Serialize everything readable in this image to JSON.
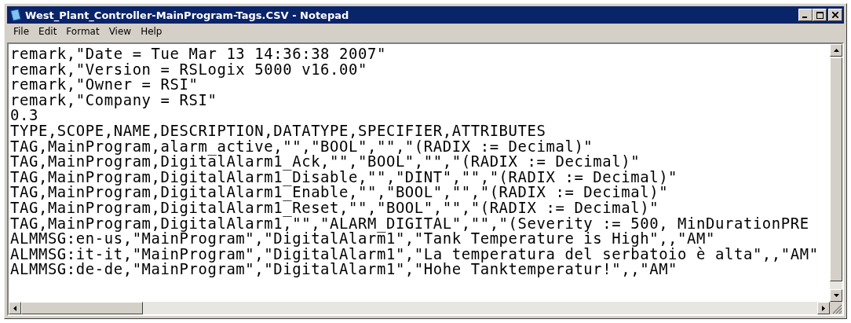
{
  "window": {
    "title": "West_Plant_Controller-MainProgram-Tags.CSV - Notepad"
  },
  "menu": [
    "File",
    "Edit",
    "Format",
    "View",
    "Help"
  ],
  "lines": [
    "remark,\"Date = Tue Mar 13 14:36:38 2007\"",
    "remark,\"Version = RSLogix 5000 v16.00\"",
    "remark,\"Owner = RSI\"",
    "remark,\"Company = RSI\"",
    "0.3",
    "TYPE,SCOPE,NAME,DESCRIPTION,DATATYPE,SPECIFIER,ATTRIBUTES",
    "TAG,MainProgram,alarm_active,\"\",\"BOOL\",\"\",\"(RADIX := Decimal)\"",
    "TAG,MainProgram,DigitalAlarm1_Ack,\"\",\"BOOL\",\"\",\"(RADIX := Decimal)\"",
    "TAG,MainProgram,DigitalAlarm1_Disable,\"\",\"DINT\",\"\",\"(RADIX := Decimal)\"",
    "TAG,MainProgram,DigitalAlarm1_Enable,\"\",\"BOOL\",\"\",\"(RADIX := Decimal)\"",
    "TAG,MainProgram,DigitalAlarm1_Reset,\"\",\"BOOL\",\"\",\"(RADIX := Decimal)\"",
    "TAG,MainProgram,DigitalAlarm1,\"\",\"ALARM_DIGITAL\",\"\",\"(Severity := 500, MinDurationPRE",
    "ALMMSG:en-us,\"MainProgram\",\"DigitalAlarm1\",\"Tank Temperature is High\",,\"AM\"",
    "ALMMSG:it-it,\"MainProgram\",\"DigitalAlarm1\",\"La temperatura del serbatoio è alta\",,\"AM\"",
    "ALMMSG:de-de,\"MainProgram\",\"DigitalAlarm1\",\"Hohe Tanktemperatur!\",,\"AM\""
  ]
}
